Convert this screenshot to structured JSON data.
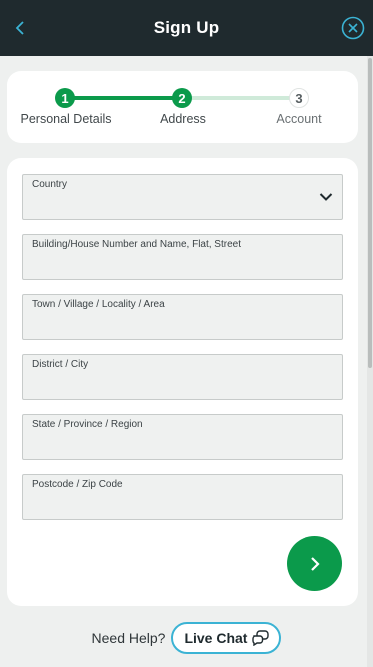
{
  "header": {
    "title": "Sign Up",
    "back_icon": "chevron-left-icon",
    "close_icon": "close-circle-icon",
    "background": "#1f2a2e",
    "accent": "#3bb3d4"
  },
  "stepper": {
    "progress_color": "#0b9a4b",
    "steps": [
      {
        "number": "1",
        "label": "Personal Details",
        "state": "done"
      },
      {
        "number": "2",
        "label": "Address",
        "state": "done"
      },
      {
        "number": "3",
        "label": "Account",
        "state": "pending"
      }
    ]
  },
  "form": {
    "fields": [
      {
        "label": "Country",
        "type": "select",
        "value": ""
      },
      {
        "label": "Building/House Number and Name, Flat, Street",
        "type": "text",
        "value": ""
      },
      {
        "label": "Town / Village / Locality / Area",
        "type": "text",
        "value": ""
      },
      {
        "label": "District / City",
        "type": "text",
        "value": ""
      },
      {
        "label": "State / Province / Region",
        "type": "text",
        "value": ""
      },
      {
        "label": "Postcode / Zip Code",
        "type": "text",
        "value": ""
      }
    ],
    "next_button_icon": "chevron-right-icon"
  },
  "help": {
    "prompt": "Need Help?",
    "chat_label": "Live Chat",
    "chat_icon": "chat-bubbles-icon"
  }
}
